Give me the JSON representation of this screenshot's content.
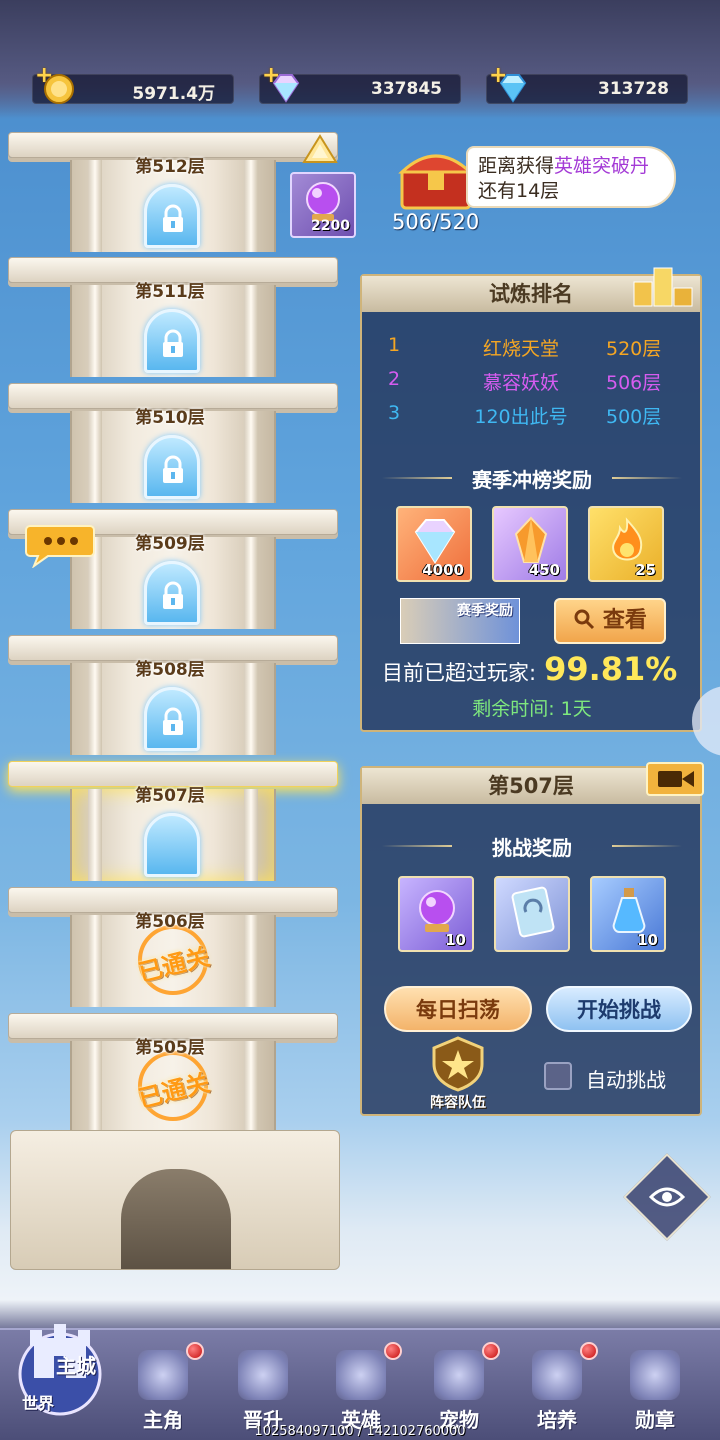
{
  "resources": [
    {
      "name": "gold",
      "value": "5971.4万",
      "icon": "gold-coin-icon"
    },
    {
      "name": "rainbow-diamond",
      "value": "337845",
      "icon": "rainbow-diamond-icon"
    },
    {
      "name": "blue-diamond",
      "value": "313728",
      "icon": "blue-diamond-icon"
    }
  ],
  "tower": {
    "floors": [
      {
        "label": "第512层",
        "state": "locked"
      },
      {
        "label": "第511层",
        "state": "locked"
      },
      {
        "label": "第510层",
        "state": "locked"
      },
      {
        "label": "第509层",
        "state": "locked"
      },
      {
        "label": "第508层",
        "state": "locked"
      },
      {
        "label": "第507层",
        "state": "current"
      },
      {
        "label": "第506层",
        "state": "cleared"
      },
      {
        "label": "第505层",
        "state": "cleared"
      }
    ],
    "cleared_stamp": "已通关",
    "floor_reward_chip": "2200"
  },
  "chest": {
    "tip_prefix": "距离获得",
    "tip_highlight": "英雄突破丹",
    "tip_suffix": "还有14层",
    "progress": "506/520"
  },
  "ranking": {
    "title": "试炼排名",
    "rows": [
      {
        "rank": "1",
        "name": "红烧天堂",
        "level": "520层",
        "color": "#f5a623"
      },
      {
        "rank": "2",
        "name": "慕容妖妖",
        "level": "506层",
        "color": "#d65cf0"
      },
      {
        "rank": "3",
        "name": "120出此号",
        "level": "500层",
        "color": "#3fb8f2"
      }
    ],
    "season_title": "赛季冲榜奖励",
    "season_items": [
      {
        "icon": "rainbow-diamond-icon",
        "count": "4000"
      },
      {
        "icon": "amber-crystal-icon",
        "count": "450"
      },
      {
        "icon": "flame-essence-icon",
        "count": "25"
      }
    ],
    "season_thumb_label": "赛季奖励",
    "view_button": "查看",
    "surpass_label": "目前已超过玩家:",
    "surpass_value": "99.81%",
    "remaining": "剩余时间: 1天"
  },
  "floor_panel": {
    "title": "第507层",
    "rewards_title": "挑战奖励",
    "rewards": [
      {
        "icon": "purple-orb-icon",
        "count": "10"
      },
      {
        "icon": "skill-card-icon",
        "count": ""
      },
      {
        "icon": "potion-bottle-icon",
        "count": "10"
      }
    ],
    "sweep_button": "每日扫荡",
    "start_button": "开始挑战",
    "team_label": "阵容队伍",
    "auto_label": "自动挑战"
  },
  "nav": {
    "home_main": "主城",
    "home_world": "世界",
    "items": [
      {
        "label": "主角",
        "badge": true
      },
      {
        "label": "晋升",
        "badge": false
      },
      {
        "label": "英雄",
        "badge": true
      },
      {
        "label": "宠物",
        "badge": true
      },
      {
        "label": "培养",
        "badge": true
      },
      {
        "label": "勋章",
        "badge": false
      }
    ]
  },
  "footer": "102584097100 / 142102760000"
}
